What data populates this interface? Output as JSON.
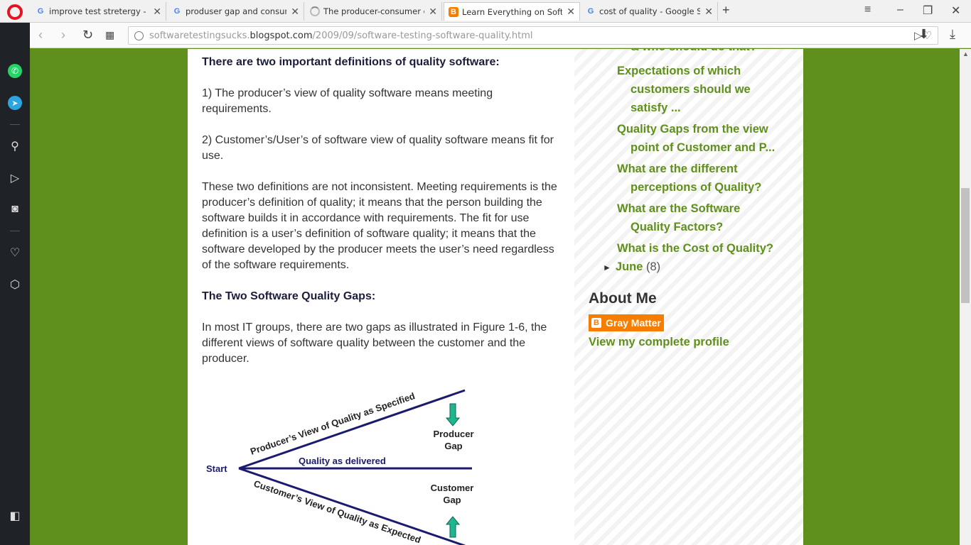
{
  "browser": {
    "tabs": [
      {
        "title": "improve test stretergy - Go",
        "favicon": "google-icon"
      },
      {
        "title": "produser gap and consum",
        "favicon": "google-icon"
      },
      {
        "title": "The producer-consumer c",
        "favicon": "loading-icon"
      },
      {
        "title": "Learn Everything on Softw",
        "favicon": "blogger-icon",
        "active": true
      },
      {
        "title": "cost of quality - Google Se",
        "favicon": "google-icon"
      }
    ],
    "url_prefix": "softwaretestingsucks.",
    "url_domain": "blogspot.com",
    "url_path": "/2009/09/software-testing-software-quality.html"
  },
  "post": {
    "definitions_heading": "There are two important definitions of quality software:",
    "def1": "1) The producer’s view of quality software means meeting requirements.",
    "def2": "2) Customer’s/User’s of software view of quality software means fit for use.",
    "para": "These two definitions are not inconsistent. Meeting requirements is the producer’s definition of quality; it means that the person building the software builds it in accordance with requirements. The fit for use definition is a user’s definition of software quality; it means that the software developed by the producer meets the user’s need regardless of the software requirements.",
    "gaps_heading": "The Two Software Quality Gaps:",
    "gaps_para": "In most IT groups, there are two gaps as illustrated in Figure 1-6, the different views of software quality between the customer and the producer."
  },
  "diagram": {
    "start": "Start",
    "producer_view": "Producer’s View of Quality as Specified",
    "delivered": "Quality as delivered",
    "customer_view": "Customer’s View of Quality as Expected",
    "producer_gap_1": "Producer",
    "producer_gap_2": "Gap",
    "customer_gap_1": "Customer",
    "customer_gap_2": "Gap"
  },
  "archive": {
    "top_partial": "& who should do that?",
    "items": [
      {
        "line1": "Expectations of which",
        "line2": "customers should we",
        "line3": "satisfy ..."
      },
      {
        "line1": "Quality Gaps from the view",
        "line2": "point of Customer and P..."
      },
      {
        "line1": "What are the different",
        "line2": "perceptions of Quality?"
      },
      {
        "line1": "What are the Software",
        "line2": "Quality Factors?"
      },
      {
        "line1": "What is the Cost of Quality?"
      }
    ],
    "june_label": "June",
    "june_count": "(8)"
  },
  "about": {
    "heading": "About Me",
    "name": "Gray Matter",
    "profile_link": "View my complete profile"
  },
  "colors": {
    "page_bg": "#5f8f1d",
    "link": "#5f8f1d",
    "heading": "#1c1c3c",
    "blogger": "#f57d00",
    "diagram_line": "#1a1a6e",
    "arrow": "#1fb58f"
  }
}
